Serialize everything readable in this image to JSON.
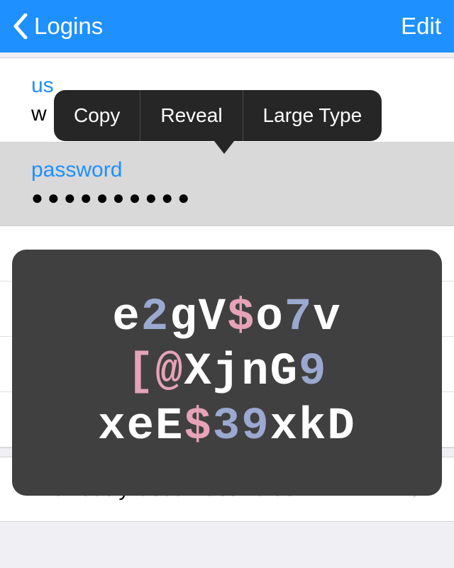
{
  "navbar": {
    "back_label": "Logins",
    "edit_label": "Edit"
  },
  "context_menu": {
    "copy": "Copy",
    "reveal": "Reveal",
    "large_type": "Large Type"
  },
  "username_row": {
    "label_prefix": "us",
    "value_prefix": "w"
  },
  "password_row": {
    "label": "password",
    "masked": "●●●●●●●●●●"
  },
  "previously_used": {
    "label": "Previously Used Passwords"
  },
  "large_type_chars": [
    [
      {
        "ch": "e",
        "cls": "c-letter"
      },
      {
        "ch": "2",
        "cls": "c-digit"
      },
      {
        "ch": "g",
        "cls": "c-letter"
      },
      {
        "ch": "V",
        "cls": "c-letter"
      },
      {
        "ch": "$",
        "cls": "c-symbol"
      },
      {
        "ch": "o",
        "cls": "c-letter"
      },
      {
        "ch": "7",
        "cls": "c-digit"
      },
      {
        "ch": "v",
        "cls": "c-letter"
      }
    ],
    [
      {
        "ch": "[",
        "cls": "c-symbol"
      },
      {
        "ch": "@",
        "cls": "c-symbol"
      },
      {
        "ch": "X",
        "cls": "c-letter"
      },
      {
        "ch": "j",
        "cls": "c-letter"
      },
      {
        "ch": "n",
        "cls": "c-letter"
      },
      {
        "ch": "G",
        "cls": "c-letter"
      },
      {
        "ch": "9",
        "cls": "c-digit"
      }
    ],
    [
      {
        "ch": "x",
        "cls": "c-letter"
      },
      {
        "ch": "e",
        "cls": "c-letter"
      },
      {
        "ch": "E",
        "cls": "c-letter"
      },
      {
        "ch": "$",
        "cls": "c-symbol"
      },
      {
        "ch": "3",
        "cls": "c-digit"
      },
      {
        "ch": "9",
        "cls": "c-digit"
      },
      {
        "ch": "x",
        "cls": "c-letter"
      },
      {
        "ch": "k",
        "cls": "c-letter"
      },
      {
        "ch": "D",
        "cls": "c-letter"
      }
    ]
  ]
}
